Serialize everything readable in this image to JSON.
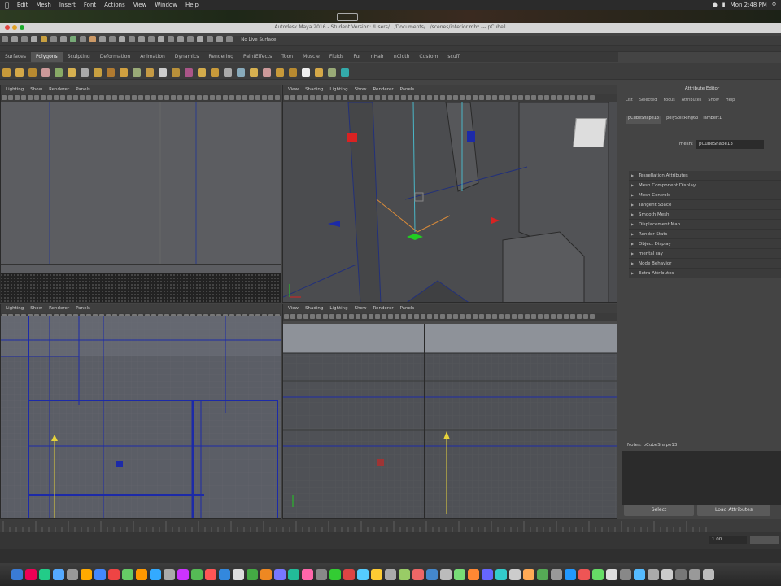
{
  "menubar": {
    "items": [
      "Edit",
      "Mesh",
      "Insert",
      "Font",
      "Actions",
      "View",
      "Window",
      "Help"
    ],
    "clock": "Mon 2:48 PM"
  },
  "window_title": "Autodesk Maya 2016 - Student Version: /Users/.../Documents/.../scenes/interior.mb* --- pCube1",
  "shelf_tabs": [
    "Surfaces",
    "Polygons",
    "Sculpting",
    "Deformation",
    "Animation",
    "Dynamics",
    "Rendering",
    "PaintEffects",
    "Toon",
    "Muscle",
    "Fluids",
    "Fur",
    "nHair",
    "nCloth",
    "Custom",
    "scuff"
  ],
  "active_tab_index": 1,
  "live_surface_label": "No Live Surface",
  "viewport_menu": [
    "View",
    "Shading",
    "Lighting",
    "Show",
    "Renderer",
    "Panels"
  ],
  "viewport_menu_short": [
    "Lighting",
    "Show",
    "Renderer",
    "Panels"
  ],
  "viewport_menu_bl": [
    "Lighting",
    "Show",
    "Renderer",
    "Panels"
  ],
  "attribute_editor": {
    "title": "Attribute Editor",
    "menu": [
      "List",
      "Selected",
      "Focus",
      "Attributes",
      "Show",
      "Help"
    ],
    "node_tabs": [
      "pCubeShape13",
      "polySplitRing63",
      "lambert1"
    ],
    "mesh_label": "mesh:",
    "mesh_value": "pCubeShape13",
    "sections": [
      "Tessellation Attributes",
      "Mesh Component Display",
      "Mesh Controls",
      "Tangent Space",
      "Smooth Mesh",
      "Displacement Map",
      "Render Stats",
      "Object Display",
      "mental ray",
      "Node Behavior",
      "Extra Attributes"
    ],
    "notes_label": "Notes:",
    "notes_value": "pCubeShape13",
    "buttons": [
      "Select",
      "Load Attributes"
    ]
  },
  "timeline": {
    "current_frame": "1.00"
  },
  "colors": {
    "maya_bg": "#444444",
    "viewport_bg": "#4a4a4a",
    "ortho_bg": "#5b5e66",
    "wire_blue": "#1c2aa8",
    "manip_yellow": "#e6d23a"
  }
}
